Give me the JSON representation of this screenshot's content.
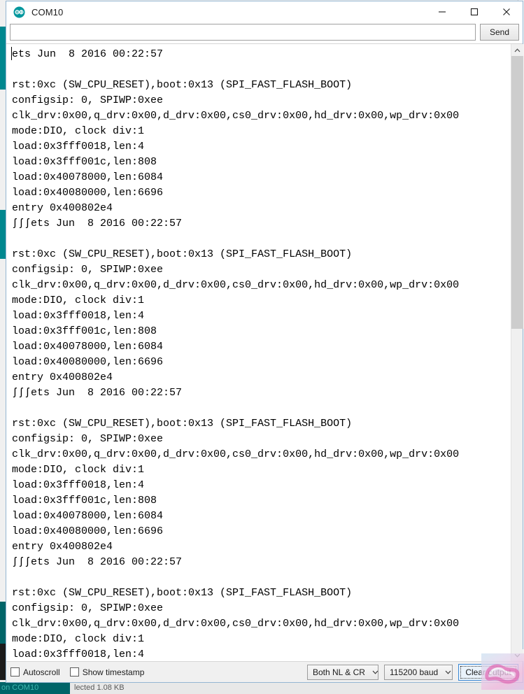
{
  "window": {
    "title": "COM10",
    "icon": "arduino-logo-icon",
    "controls": {
      "minimize": "minimize-icon",
      "maximize": "maximize-icon",
      "close": "close-icon"
    }
  },
  "send_row": {
    "input_value": "",
    "input_placeholder": "",
    "send_label": "Send"
  },
  "console": {
    "text": "ets Jun  8 2016 00:22:57\n\nrst:0xc (SW_CPU_RESET),boot:0x13 (SPI_FAST_FLASH_BOOT)\nconfigsip: 0, SPIWP:0xee\nclk_drv:0x00,q_drv:0x00,d_drv:0x00,cs0_drv:0x00,hd_drv:0x00,wp_drv:0x00\nmode:DIO, clock div:1\nload:0x3fff0018,len:4\nload:0x3fff001c,len:808\nload:0x40078000,len:6084\nload:0x40080000,len:6696\nentry 0x400802e4\nʃʃʃets Jun  8 2016 00:22:57\n\nrst:0xc (SW_CPU_RESET),boot:0x13 (SPI_FAST_FLASH_BOOT)\nconfigsip: 0, SPIWP:0xee\nclk_drv:0x00,q_drv:0x00,d_drv:0x00,cs0_drv:0x00,hd_drv:0x00,wp_drv:0x00\nmode:DIO, clock div:1\nload:0x3fff0018,len:4\nload:0x3fff001c,len:808\nload:0x40078000,len:6084\nload:0x40080000,len:6696\nentry 0x400802e4\nʃʃʃets Jun  8 2016 00:22:57\n\nrst:0xc (SW_CPU_RESET),boot:0x13 (SPI_FAST_FLASH_BOOT)\nconfigsip: 0, SPIWP:0xee\nclk_drv:0x00,q_drv:0x00,d_drv:0x00,cs0_drv:0x00,hd_drv:0x00,wp_drv:0x00\nmode:DIO, clock div:1\nload:0x3fff0018,len:4\nload:0x3fff001c,len:808\nload:0x40078000,len:6084\nload:0x40080000,len:6696\nentry 0x400802e4\nʃʃʃets Jun  8 2016 00:22:57\n\nrst:0xc (SW_CPU_RESET),boot:0x13 (SPI_FAST_FLASH_BOOT)\nconfigsip: 0, SPIWP:0xee\nclk_drv:0x00,q_drv:0x00,d_drv:0x00,cs0_drv:0x00,hd_drv:0x00,wp_drv:0x00\nmode:DIO, clock div:1\nload:0x3fff0018,len:4",
    "scrollbar": {
      "up_arrow": "chevron-up-icon",
      "down_arrow": "chevron-down-icon"
    }
  },
  "bottom_bar": {
    "autoscroll_label": "Autoscroll",
    "autoscroll_checked": false,
    "timestamp_label": "Show timestamp",
    "timestamp_checked": false,
    "line_ending_selected": "Both NL & CR",
    "baud_selected": "115200 baud",
    "clear_output_label": "Clear output"
  },
  "background_ide": {
    "status_left": "on COM10",
    "status_right": "lected 1.08 KB"
  },
  "colors": {
    "arduino_teal": "#00878f",
    "window_border": "#94b6d2",
    "focus_blue": "#3c8ad6",
    "console_fg": "#000000",
    "console_bg": "#ffffff",
    "scrollbar_thumb": "#cdcdcd"
  }
}
